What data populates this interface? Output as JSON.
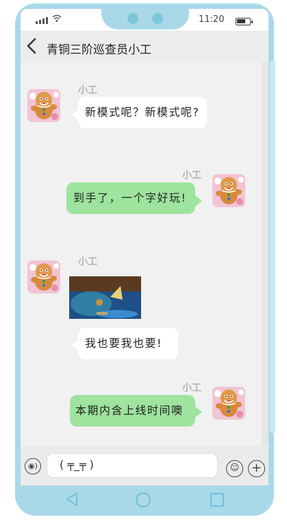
{
  "status": {
    "time": "11:20",
    "battery_level": 0.7
  },
  "header": {
    "title": "青铜三阶巡查员小工",
    "back_icon": "chevron-left-icon"
  },
  "messages": [
    {
      "side": "left",
      "sender": "小工",
      "type": "text",
      "text": "新模式呢？新模式呢?"
    },
    {
      "side": "right",
      "sender": "小工",
      "type": "text",
      "text": "到手了，一个字好玩!"
    },
    {
      "side": "left",
      "sender": "小工",
      "type": "image",
      "image_desc": "cartoon-scene-icon"
    },
    {
      "side": "left",
      "sender": "",
      "type": "text",
      "text": "我也要我也要!"
    },
    {
      "side": "right",
      "sender": "小工",
      "type": "text",
      "text": "本期内含上线时间噢"
    }
  ],
  "input": {
    "value": "( ╤_╤ )"
  },
  "colors": {
    "phone_frame": "#a9d9e8",
    "green_bubble": "#9ee39e",
    "screen_bg": "#f1f1f1"
  }
}
